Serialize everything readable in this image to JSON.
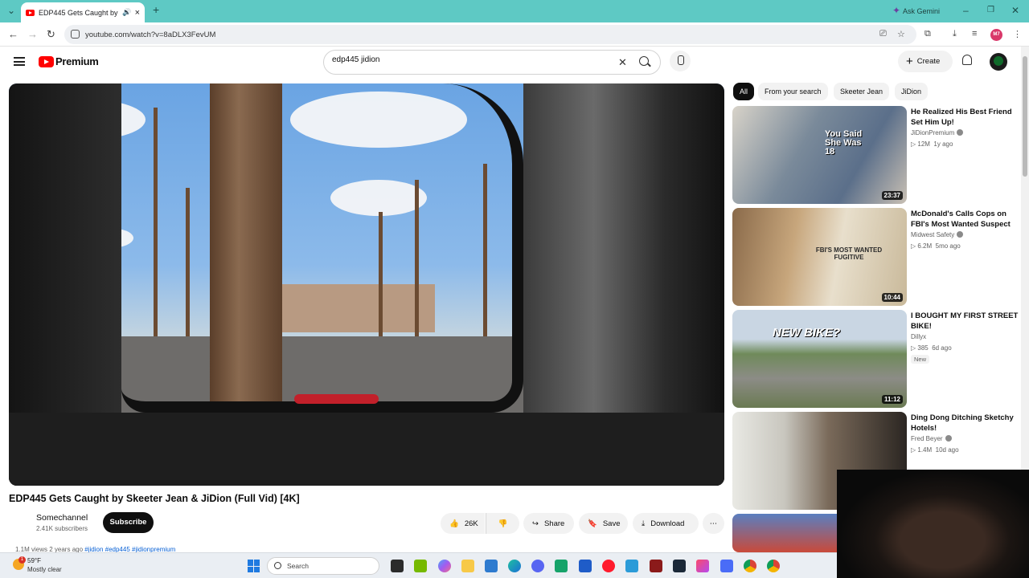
{
  "browser": {
    "tab_title": "EDP445 Gets Caught by Skeeter Jean & JiDion (Full Vid) [4K]",
    "tab_title_display": "EDP445 Gets Caught by Ske",
    "ask_gemini": "Ask Gemini",
    "url": "youtube.com/watch?v=8aDLX3FevUM",
    "profile_initials": "M7"
  },
  "youtube": {
    "brand": "Premium",
    "search_query": "edp445 jidion",
    "create_label": "Create"
  },
  "video": {
    "title": "EDP445 Gets Caught by Skeeter Jean & JiDion (Full Vid) [4K]",
    "channel": "Somechannel",
    "subscribers": "2.41K subscribers",
    "subscribe_label": "Subscribe",
    "likes": "26K",
    "share_label": "Share",
    "save_label": "Save",
    "download_label": "Download",
    "views_line": "1.1M views  2 years ago",
    "tags": "#jidion #edp445 #jidionpremium"
  },
  "chips": [
    "All",
    "From your search",
    "Skeeter Jean",
    "JiDion"
  ],
  "recommendations": [
    {
      "title": "He Realized His Best Friend Set Him Up!",
      "channel": "JiDionPremium",
      "verified": true,
      "views": "12M",
      "age": "1y ago",
      "duration": "23:37",
      "thumb_text": "You Said She Was 18"
    },
    {
      "title": "McDonald's Calls Cops on FBI's Most Wanted Suspect",
      "channel": "Midwest Safety",
      "verified": true,
      "views": "6.2M",
      "age": "5mo ago",
      "duration": "10:44",
      "thumb_text": "FBI'S MOST WANTED FUGITIVE"
    },
    {
      "title": "I BOUGHT MY FIRST STREET BIKE!",
      "channel": "Dillyx",
      "verified": false,
      "views": "385",
      "age": "6d ago",
      "duration": "11:12",
      "badge": "New",
      "thumb_text": "NEW BIKE?"
    },
    {
      "title": "Ding Dong Ditching Sketchy Hotels!",
      "channel": "Fred Beyer",
      "verified": true,
      "views": "1.4M",
      "age": "10d ago",
      "duration": ""
    }
  ],
  "taskbar": {
    "temperature": "59°F",
    "condition": "Mostly clear",
    "search_label": "Search",
    "weather_badge": "1"
  },
  "colors": {
    "tab_bar": "#5ec9c4",
    "youtube_red": "#ff0000",
    "subscribe_bg": "#0f0f0f",
    "link_blue": "#065fd4"
  }
}
